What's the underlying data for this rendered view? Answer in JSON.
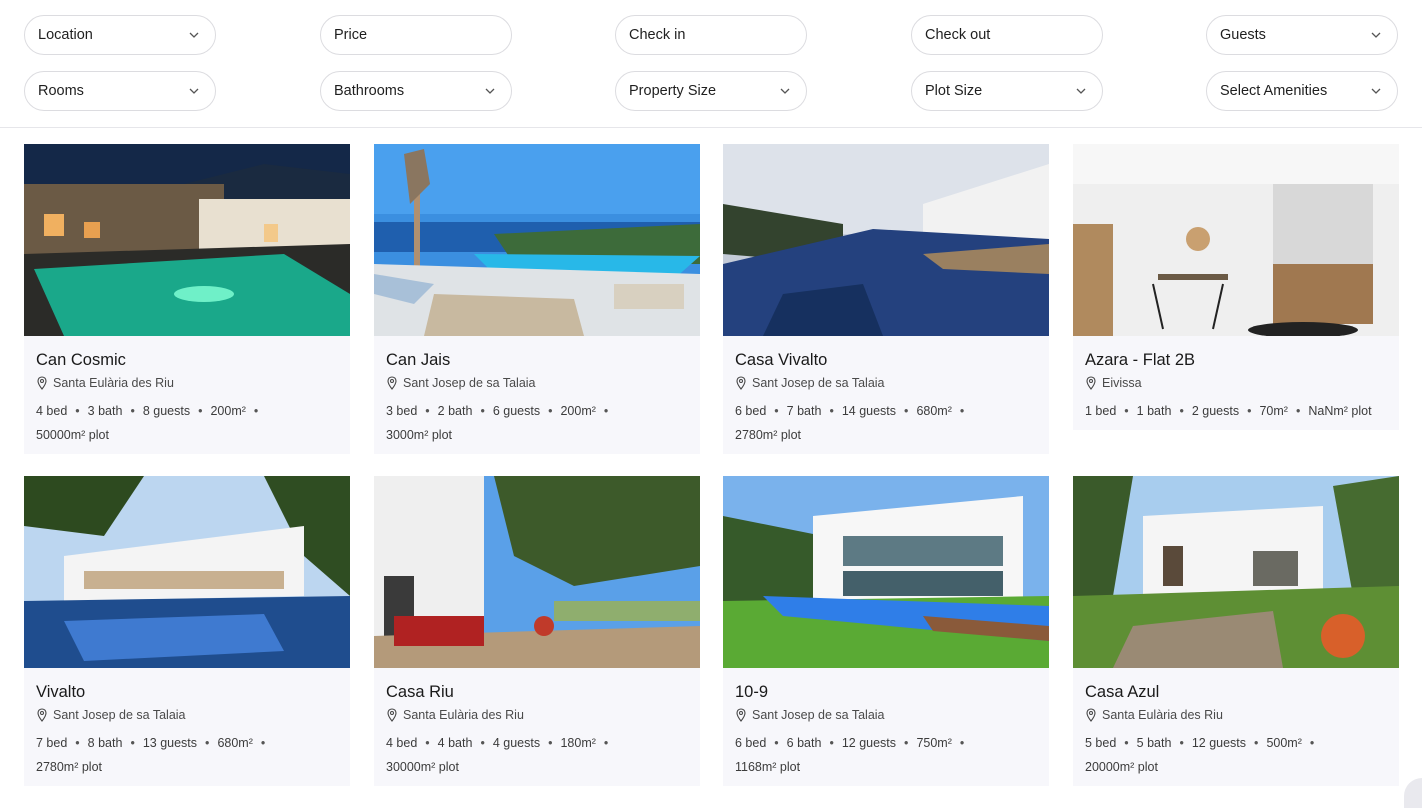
{
  "filters": {
    "row1": [
      {
        "label": "Location",
        "dropdown": true
      },
      {
        "label": "Price",
        "dropdown": false
      },
      {
        "label": "Check in",
        "dropdown": false
      },
      {
        "label": "Check out",
        "dropdown": false
      },
      {
        "label": "Guests",
        "dropdown": true
      }
    ],
    "row2": [
      {
        "label": "Rooms",
        "dropdown": true
      },
      {
        "label": "Bathrooms",
        "dropdown": true
      },
      {
        "label": "Property Size",
        "dropdown": true
      },
      {
        "label": "Plot Size",
        "dropdown": true
      },
      {
        "label": "Select Amenities",
        "dropdown": true
      }
    ]
  },
  "icons": {
    "dropdown": "chevron-down-icon",
    "location": "map-pin-icon"
  },
  "listings": [
    {
      "name": "Can Cosmic",
      "location": "Santa Eulària des Riu",
      "beds": "4 bed",
      "baths": "3 bath",
      "guests": "8 guests",
      "size": "200m²",
      "plot": "50000m² plot",
      "photo": "night-pool"
    },
    {
      "name": "Can Jais",
      "location": "Sant Josep de sa Talaia",
      "beds": "3 bed",
      "baths": "2 bath",
      "guests": "6 guests",
      "size": "200m²",
      "plot": "3000m² plot",
      "photo": "sea-pool"
    },
    {
      "name": "Casa Vivalto",
      "location": "Sant Josep de sa Talaia",
      "beds": "6 bed",
      "baths": "7 bath",
      "guests": "14 guests",
      "size": "680m²",
      "plot": "2780m² plot",
      "photo": "infinity-pool"
    },
    {
      "name": "Azara - Flat 2B",
      "location": "Eivissa",
      "beds": "1 bed",
      "baths": "1 bath",
      "guests": "2 guests",
      "size": "70m²",
      "plot": "NaNm² plot",
      "photo": "interior"
    },
    {
      "name": "Vivalto",
      "location": "Sant Josep de sa Talaia",
      "beds": "7 bed",
      "baths": "8 bath",
      "guests": "13 guests",
      "size": "680m²",
      "plot": "2780m² plot",
      "photo": "white-villa-pool"
    },
    {
      "name": "Casa Riu",
      "location": "Santa Eulària des Riu",
      "beds": "4 bed",
      "baths": "4 bath",
      "guests": "4 guests",
      "size": "180m²",
      "plot": "30000m² plot",
      "photo": "terrace"
    },
    {
      "name": "10-9",
      "location": "Sant Josep de sa Talaia",
      "beds": "6 bed",
      "baths": "6 bath",
      "guests": "12 guests",
      "size": "750m²",
      "plot": "1168m² plot",
      "photo": "modern-villa"
    },
    {
      "name": "Casa Azul",
      "location": "Santa Eulària des Riu",
      "beds": "5 bed",
      "baths": "5 bath",
      "guests": "12 guests",
      "size": "500m²",
      "plot": "20000m² plot",
      "photo": "garden-villa"
    }
  ],
  "colors": {
    "card_bg": "#f7f7fb",
    "border": "#dcdce0",
    "text": "#1a1a1a"
  }
}
